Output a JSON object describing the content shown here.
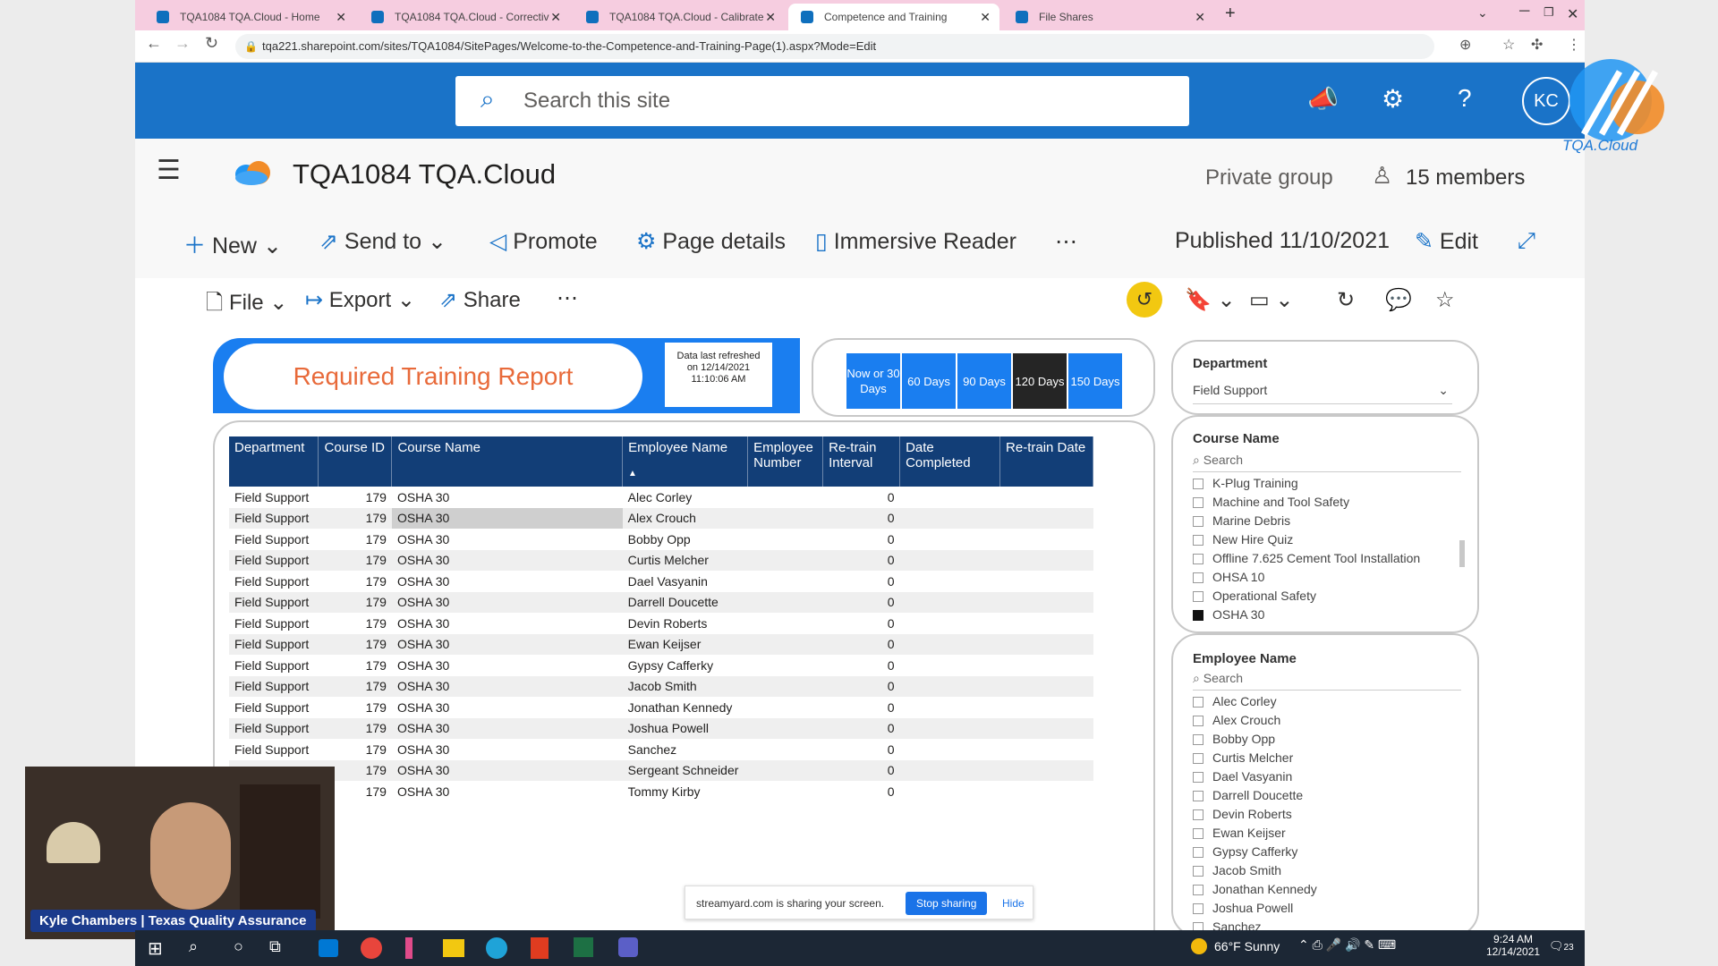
{
  "tabs": [
    {
      "title": "TQA1084 TQA.Cloud - Home"
    },
    {
      "title": "TQA1084 TQA.Cloud - Correctiv"
    },
    {
      "title": "TQA1084 TQA.Cloud - Calibrate"
    },
    {
      "title": "Competence and Training"
    },
    {
      "title": "File Shares"
    }
  ],
  "url": "tqa221.sharepoint.com/sites/TQA1084/SitePages/Welcome-to-the-Competence-and-Training-Page(1).aspx?Mode=Edit",
  "search": {
    "placeholder": "Search this site"
  },
  "avatar": "KC",
  "site": {
    "title": "TQA1084 TQA.Cloud",
    "private": "Private group",
    "members": "15 members"
  },
  "command_bar": {
    "new": "New",
    "send_to": "Send to",
    "promote": "Promote",
    "page_details": "Page details",
    "immersive": "Immersive Reader",
    "published": "Published 11/10/2021",
    "edit": "Edit"
  },
  "pbi_toolbar": {
    "file": "File",
    "export": "Export",
    "share": "Share"
  },
  "report": {
    "title": "Required Training Report",
    "refreshed": "Data last refreshed on 12/14/2021 11:10:06 AM"
  },
  "day_buttons": [
    {
      "label": "Now or 30 Days"
    },
    {
      "label": "60 Days"
    },
    {
      "label": "90 Days"
    },
    {
      "label": "120 Days"
    },
    {
      "label": "150 Days"
    }
  ],
  "table": {
    "headers": [
      "Department",
      "Course ID",
      "Course Name",
      "Employee Name",
      "Employee Number",
      "Re-train Interval",
      "Date Completed",
      "Re-train Date"
    ],
    "rows": [
      [
        "Field Support",
        "179",
        "OSHA 30",
        "Alec Corley",
        "",
        "0",
        "",
        ""
      ],
      [
        "Field Support",
        "179",
        "OSHA 30",
        "Alex Crouch",
        "",
        "0",
        "",
        ""
      ],
      [
        "Field Support",
        "179",
        "OSHA 30",
        "Bobby Opp",
        "",
        "0",
        "",
        ""
      ],
      [
        "Field Support",
        "179",
        "OSHA 30",
        "Curtis Melcher",
        "",
        "0",
        "",
        ""
      ],
      [
        "Field Support",
        "179",
        "OSHA 30",
        "Dael Vasyanin",
        "",
        "0",
        "",
        ""
      ],
      [
        "Field Support",
        "179",
        "OSHA 30",
        "Darrell Doucette",
        "",
        "0",
        "",
        ""
      ],
      [
        "Field Support",
        "179",
        "OSHA 30",
        "Devin Roberts",
        "",
        "0",
        "",
        ""
      ],
      [
        "Field Support",
        "179",
        "OSHA 30",
        "Ewan Keijser",
        "",
        "0",
        "",
        ""
      ],
      [
        "Field Support",
        "179",
        "OSHA 30",
        "Gypsy Cafferky",
        "",
        "0",
        "",
        ""
      ],
      [
        "Field Support",
        "179",
        "OSHA 30",
        "Jacob Smith",
        "",
        "0",
        "",
        ""
      ],
      [
        "Field Support",
        "179",
        "OSHA 30",
        "Jonathan Kennedy",
        "",
        "0",
        "",
        ""
      ],
      [
        "Field Support",
        "179",
        "OSHA 30",
        "Joshua Powell",
        "",
        "0",
        "",
        ""
      ],
      [
        "Field Support",
        "179",
        "OSHA 30",
        "Sanchez",
        "",
        "0",
        "",
        ""
      ],
      [
        "",
        "179",
        "OSHA 30",
        "Sergeant Schneider",
        "",
        "0",
        "",
        ""
      ],
      [
        "",
        "179",
        "OSHA 30",
        "Tommy Kirby",
        "",
        "0",
        "",
        ""
      ]
    ]
  },
  "filters": {
    "department": {
      "label": "Department",
      "value": "Field Support"
    },
    "course": {
      "label": "Course Name",
      "search": "Search",
      "items": [
        {
          "name": "K-Plug Training",
          "checked": false
        },
        {
          "name": "Machine and Tool Safety",
          "checked": false
        },
        {
          "name": "Marine Debris",
          "checked": false
        },
        {
          "name": "New Hire Quiz",
          "checked": false
        },
        {
          "name": "Offline 7.625 Cement Tool Installation",
          "checked": false
        },
        {
          "name": "OHSA 10",
          "checked": false
        },
        {
          "name": "Operational Safety",
          "checked": false
        },
        {
          "name": "OSHA 30",
          "checked": true
        }
      ]
    },
    "employee": {
      "label": "Employee Name",
      "search": "Search",
      "items": [
        "Alec Corley",
        "Alex Crouch",
        "Bobby Opp",
        "Curtis Melcher",
        "Dael Vasyanin",
        "Darrell Doucette",
        "Devin Roberts",
        "Ewan Keijser",
        "Gypsy Cafferky",
        "Jacob Smith",
        "Jonathan Kennedy",
        "Joshua Powell",
        "Sanchez"
      ]
    }
  },
  "share_banner": {
    "text": "streamyard.com is sharing your screen.",
    "stop": "Stop sharing",
    "hide": "Hide"
  },
  "presenter": "Kyle Chambers | Texas Quality Assurance",
  "logo_text": "TQA.Cloud",
  "taskbar": {
    "weather": "66°F Sunny",
    "time": "9:24 AM",
    "date": "12/14/2021",
    "notif": "23"
  }
}
